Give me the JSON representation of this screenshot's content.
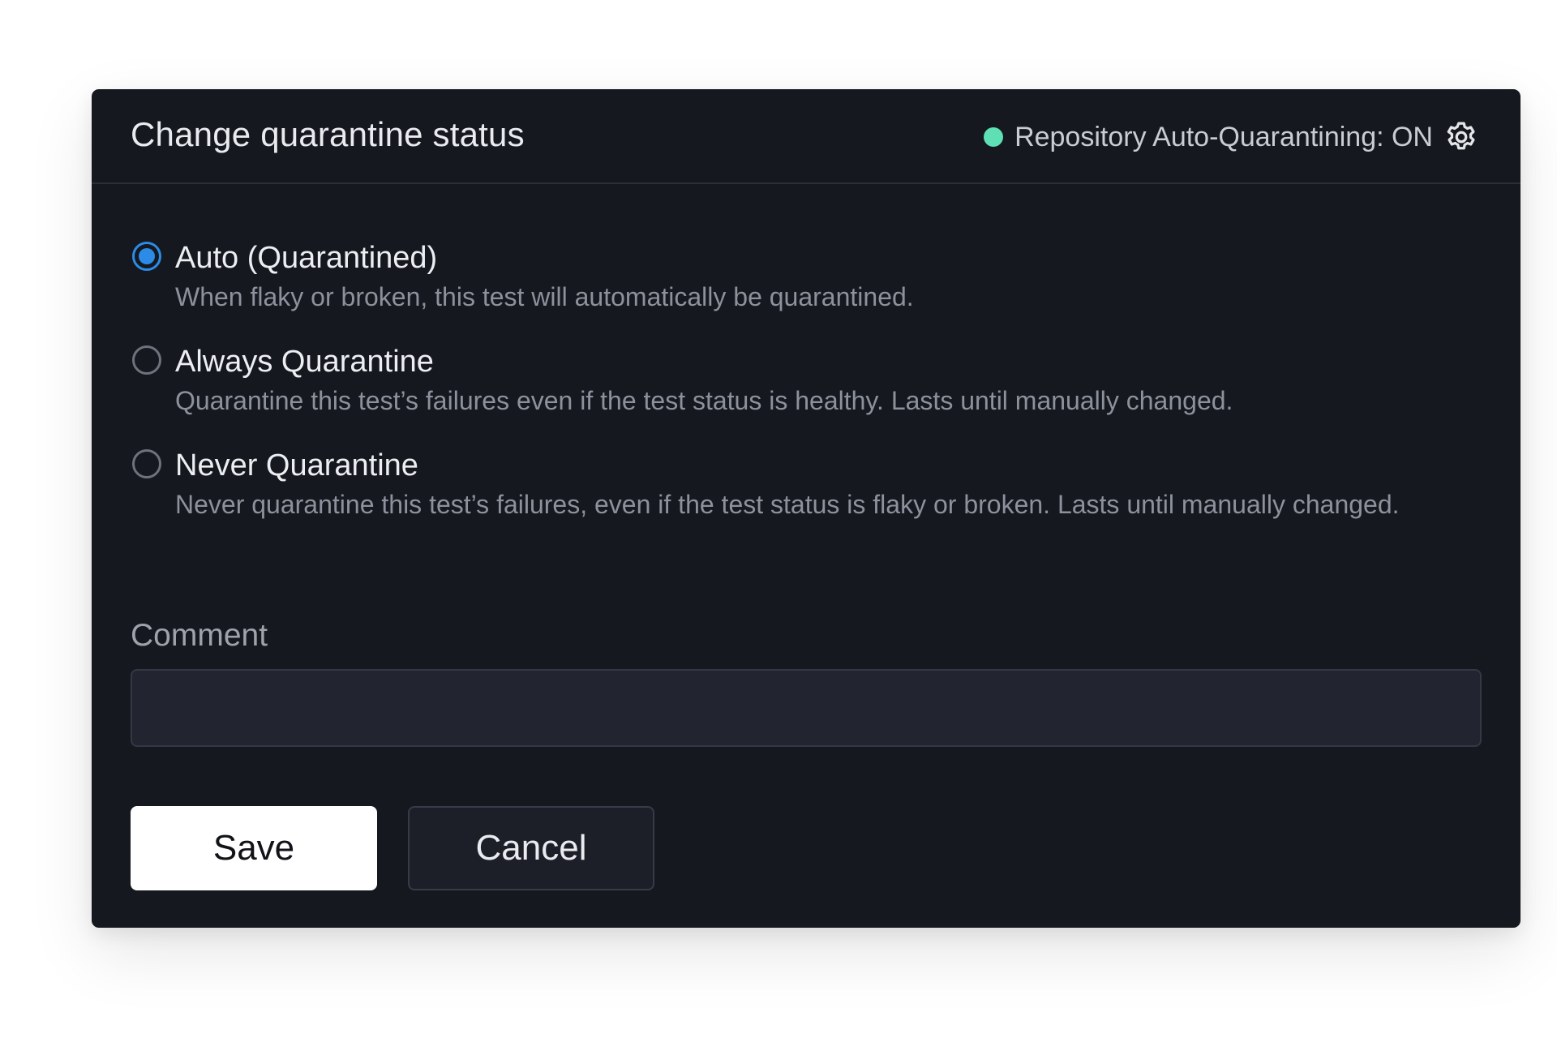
{
  "dialog": {
    "title": "Change quarantine status",
    "status": {
      "text": "Repository Auto-Quarantining: ON",
      "dot_color": "#5fe0b4",
      "icon": "gear-icon"
    },
    "options": [
      {
        "label": "Auto (Quarantined)",
        "description": "When flaky or broken, this test will automatically be quarantined.",
        "selected": true
      },
      {
        "label": "Always Quarantine",
        "description": "Quarantine this test’s failures even if the test status is healthy. Lasts until manually changed.",
        "selected": false
      },
      {
        "label": "Never Quarantine",
        "description": "Never quarantine this test’s failures, even if the test status is flaky or broken. Lasts until manually changed.",
        "selected": false
      }
    ],
    "comment": {
      "label": "Comment",
      "value": "",
      "placeholder": ""
    },
    "buttons": {
      "save": "Save",
      "cancel": "Cancel"
    },
    "colors": {
      "background": "#15181f",
      "accent": "#2b8be6",
      "status_on": "#5fe0b4"
    }
  }
}
